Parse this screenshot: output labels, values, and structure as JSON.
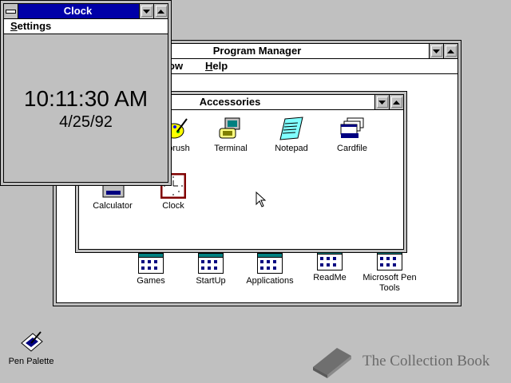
{
  "desktop": {
    "pen_palette_label": "Pen Palette",
    "watermark": "The Collection Book"
  },
  "program_manager": {
    "title": "Program Manager",
    "menu": {
      "window_partial": "ow",
      "help": "Help"
    },
    "groups": [
      {
        "label": "Games"
      },
      {
        "label": "StartUp"
      },
      {
        "label": "Applications"
      },
      {
        "label": "ReadMe"
      },
      {
        "label": "Microsoft Pen Tools"
      }
    ]
  },
  "accessories": {
    "title": "Accessories",
    "items": [
      {
        "label": "brush"
      },
      {
        "label": "Terminal"
      },
      {
        "label": "Notepad"
      },
      {
        "label": "Cardfile"
      },
      {
        "label": "Calculator"
      },
      {
        "label": "Clock"
      }
    ]
  },
  "clock": {
    "title": "Clock",
    "menu_settings": "Settings",
    "time": "10:11:30 AM",
    "date": "4/25/92"
  },
  "colors": {
    "active_title": "#0000a8",
    "desktop": "#c0c0c0"
  }
}
